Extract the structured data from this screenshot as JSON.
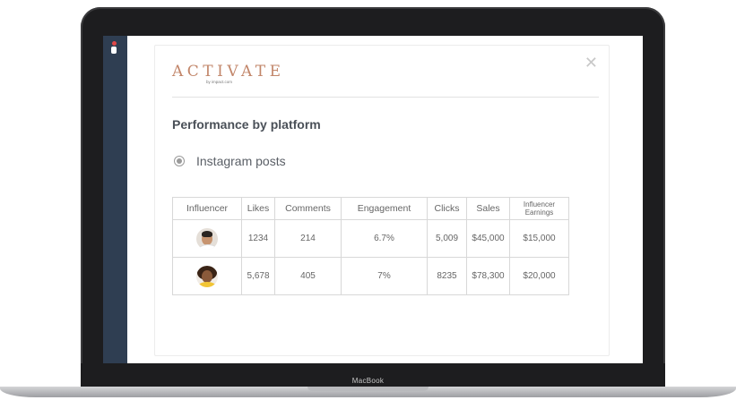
{
  "device": {
    "label": "MacBook"
  },
  "app": {
    "brand": {
      "name": "ACTIVATE",
      "sub": "by impact.com"
    }
  },
  "modal": {
    "close_glyph": "✕",
    "section_title": "Performance by platform",
    "platform_option": {
      "label": "Instagram posts",
      "selected": true
    }
  },
  "table": {
    "headers": [
      "Influencer",
      "Likes",
      "Comments",
      "Engagement",
      "Clicks",
      "Sales",
      "Influencer Earnings"
    ],
    "rows": [
      {
        "avatar": "man-with-glasses-avatar",
        "likes": "1234",
        "comments": "214",
        "engagement": "6.7%",
        "clicks": "5,009",
        "sales": "$45,000",
        "earnings": "$15,000"
      },
      {
        "avatar": "woman-with-curly-hair-avatar",
        "likes": "5,678",
        "comments": "405",
        "engagement": "7%",
        "clicks": "8235",
        "sales": "$78,300",
        "earnings": "$20,000"
      }
    ]
  },
  "colors": {
    "brand": "#c2866a",
    "sidebar": "#2f3e52"
  }
}
